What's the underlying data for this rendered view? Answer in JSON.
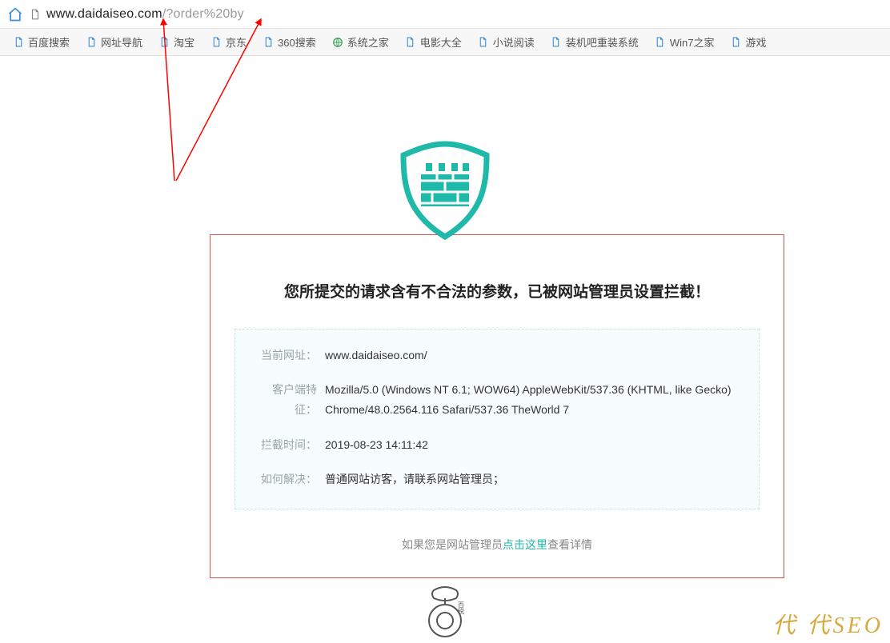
{
  "address_bar": {
    "url_main": "www.daidaiseo.com",
    "url_query": "/?order%20by"
  },
  "bookmarks": [
    {
      "label": "百度搜索",
      "icon": "file"
    },
    {
      "label": "网址导航",
      "icon": "file"
    },
    {
      "label": "淘宝",
      "icon": "file"
    },
    {
      "label": "京东",
      "icon": "file"
    },
    {
      "label": "360搜索",
      "icon": "file"
    },
    {
      "label": "系统之家",
      "icon": "globe"
    },
    {
      "label": "电影大全",
      "icon": "file"
    },
    {
      "label": "小说阅读",
      "icon": "file"
    },
    {
      "label": "装机吧重装系统",
      "icon": "file"
    },
    {
      "label": "Win7之家",
      "icon": "file"
    },
    {
      "label": "游戏",
      "icon": "file"
    }
  ],
  "panel": {
    "heading": "您所提交的请求含有不合法的参数，已被网站管理员设置拦截！",
    "rows": {
      "current_url": {
        "label": "当前网址：",
        "value": "www.daidaiseo.com/"
      },
      "user_agent": {
        "label": "客户端特征：",
        "value": "Mozilla/5.0 (Windows NT 6.1; WOW64) AppleWebKit/537.36 (KHTML, like Gecko) Chrome/48.0.2564.116 Safari/537.36 TheWorld 7"
      },
      "blocked_at": {
        "label": "拦截时间：",
        "value": "2019-08-23 14:11:42"
      },
      "solution": {
        "label": "如何解决：",
        "value": "普通网站访客，请联系网站管理员；"
      }
    },
    "footer": {
      "prefix": "如果您是网站管理员",
      "link": "点击这里",
      "suffix": "查看详情"
    }
  },
  "watermark": "代 代SEO",
  "colors": {
    "teal": "#1eb9a8",
    "red_border": "#d9534f",
    "dash": "#bfe8e2"
  }
}
